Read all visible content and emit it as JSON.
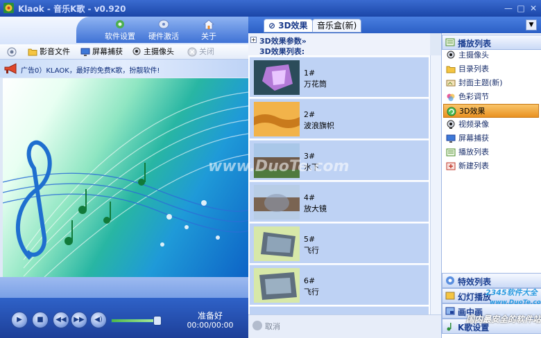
{
  "window": {
    "title": "Klaok - 音乐K歌 - v0.920",
    "minimize": "—",
    "maximize": "□",
    "close": "✕"
  },
  "top_buttons": [
    {
      "label": "软件设置",
      "icon": "settings-gear-icon"
    },
    {
      "label": "硬件激活",
      "icon": "hardware-activate-icon"
    },
    {
      "label": "关于",
      "icon": "home-icon"
    }
  ],
  "toolbar": {
    "media_file": "影音文件",
    "screen_capture": "屏幕捕获",
    "main_camera": "主摄像头",
    "close": "关闭"
  },
  "ad_text": "广告0）KLAOK，最好的免费K歌，扮靓软件!",
  "player": {
    "status": "准备好",
    "time": "00:00/00:00",
    "volume": 0.85,
    "progress": 0.0
  },
  "tabs": [
    {
      "label": "3D效果",
      "active": true
    },
    {
      "label": "音乐盒(新)",
      "active": false
    }
  ],
  "panel": {
    "params_heading": "3D效果参数»",
    "list_heading": "3D效果列表:"
  },
  "effects": [
    {
      "num": "1#",
      "name": "万花筒"
    },
    {
      "num": "2#",
      "name": "波浪旗帜"
    },
    {
      "num": "3#",
      "name": "水下"
    },
    {
      "num": "4#",
      "name": "放大镜"
    },
    {
      "num": "5#",
      "name": "飞行"
    },
    {
      "num": "6#",
      "name": "飞行"
    }
  ],
  "cancel_label": "取消",
  "sidebar": {
    "play_list_heading": "播放列表",
    "items": [
      {
        "label": "主摄像头",
        "icon": "webcam-icon"
      },
      {
        "label": "目录列表",
        "icon": "folder-icon"
      },
      {
        "label": "封面主题(新)",
        "icon": "theme-icon"
      },
      {
        "label": "色彩调节",
        "icon": "color-adjust-icon"
      },
      {
        "label": "3D效果",
        "icon": "3d-effect-icon",
        "selected": true
      },
      {
        "label": "视频录像",
        "icon": "video-record-icon"
      },
      {
        "label": "屏幕捕获",
        "icon": "screen-capture-icon"
      },
      {
        "label": "播放列表",
        "icon": "playlist-icon"
      },
      {
        "label": "新建列表",
        "icon": "new-list-icon"
      }
    ],
    "bottom_headings": [
      "特效列表",
      "幻灯播放",
      "画中画",
      "K歌设置"
    ]
  },
  "watermarks": [
    "www.DuoTe.com",
    "2345软件大全",
    "www.DuoTe.com",
    "国内最安全的软件站"
  ]
}
